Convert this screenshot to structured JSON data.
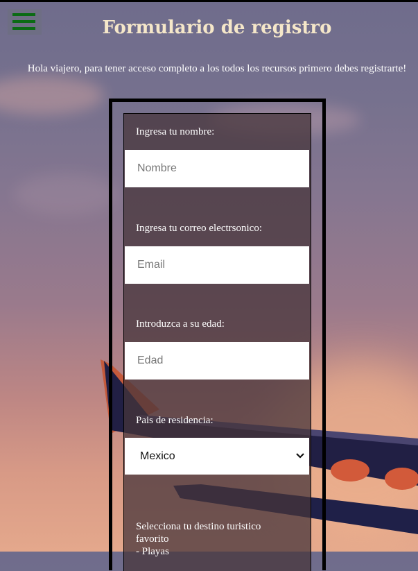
{
  "header": {
    "title": "Formulario de registro",
    "intro": "Hola viajero, para tener acceso completo a los todos los recursos primero debes registrarte!",
    "menu_icon": "hamburger-menu-icon",
    "menu_icon_color": "#0b6b14"
  },
  "form": {
    "name_label": "Ingresa tu nombre:",
    "name_placeholder": "Nombre",
    "email_label": "Ingresa tu correo electrsonico:",
    "email_placeholder": "Email",
    "age_label": "Introduzca a su edad:",
    "age_placeholder": "Edad",
    "country_label": "Pais de residencia:",
    "country_value": "Mexico",
    "destination_label": "Selecciona tu destino turistico favorito",
    "destination_option": "- Playas"
  },
  "colors": {
    "title": "#f5e7c9",
    "form_background": "#46343a",
    "text": "#ffffff"
  }
}
